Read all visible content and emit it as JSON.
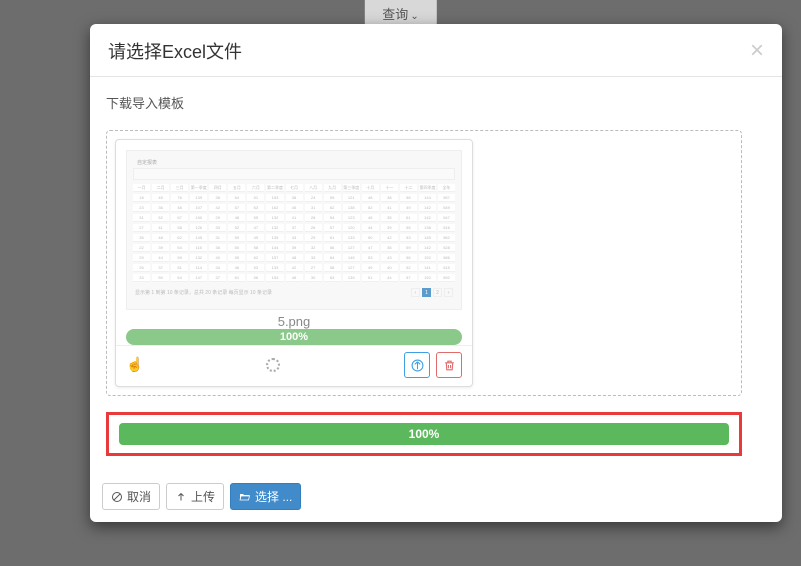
{
  "background_button": "查询",
  "modal": {
    "title": "请选择Excel文件",
    "template_link": "下载导入模板"
  },
  "file": {
    "name": "5.png",
    "progress_label": "100%"
  },
  "main_progress": "100%",
  "footer": {
    "cancel": "取消",
    "upload": "上传",
    "select": "选择 ..."
  },
  "thumbnail": {
    "title_label": "自定报表",
    "header_groups": [
      "第一季度",
      "第二季度",
      "第三季度",
      "第四季度"
    ],
    "year_col": "全年汇总",
    "columns": [
      "一月",
      "二月",
      "三月",
      "第一季度",
      "四月",
      "五月",
      "六月",
      "第二季度",
      "七月",
      "八月",
      "九月",
      "第三季度",
      "十月",
      "十一月",
      "十二月",
      "第四季度"
    ],
    "footer_text": "显示第 1 到第 10 条记录，总共 20 条记录 每页显示 10 条记录"
  }
}
